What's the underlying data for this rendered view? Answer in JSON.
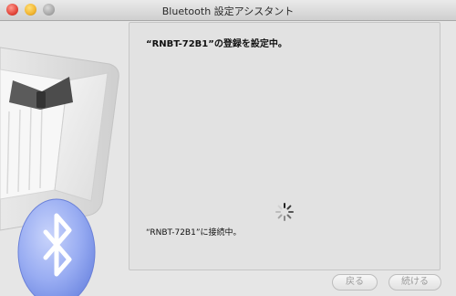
{
  "window": {
    "title": "Bluetooth 設定アシスタント"
  },
  "panel": {
    "headline": "“RNBT-72B1”の登録を設定中。",
    "status_text": "“RNBT-72B1”に接続中。"
  },
  "buttons": {
    "back_label": "戻る",
    "continue_label": "続ける"
  },
  "icons": {
    "illustration": "butler-tuxedo-bluetooth-icon",
    "spinner": "progress-spinner-icon"
  },
  "colors": {
    "window_bg": "#e6e6e6",
    "panel_bg": "#e2e2e2",
    "bluetooth_blue": "#8ea6f0",
    "disabled_text": "#9a9a9a"
  }
}
